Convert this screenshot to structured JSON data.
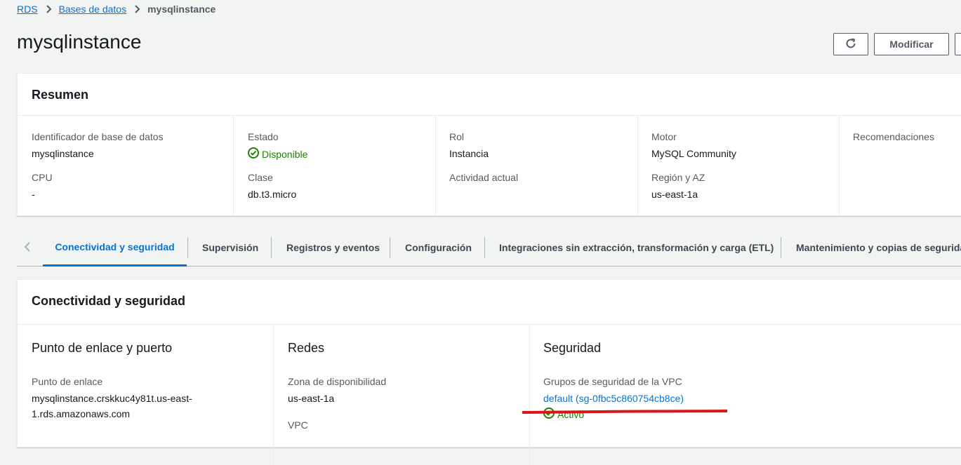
{
  "breadcrumb": {
    "items": [
      "RDS",
      "Bases de datos"
    ],
    "current": "mysqlinstance"
  },
  "header": {
    "title": "mysqlinstance",
    "modify_label": "Modificar"
  },
  "summary": {
    "title": "Resumen",
    "fields": {
      "db_id_label": "Identificador de base de datos",
      "db_id_value": "mysqlinstance",
      "cpu_label": "CPU",
      "cpu_value": "-",
      "estado_label": "Estado",
      "estado_value": "Disponible",
      "clase_label": "Clase",
      "clase_value": "db.t3.micro",
      "rol_label": "Rol",
      "rol_value": "Instancia",
      "actividad_label": "Actividad actual",
      "motor_label": "Motor",
      "motor_value": "MySQL Community",
      "region_label": "Región y AZ",
      "region_value": "us-east-1a",
      "recomendaciones_label": "Recomendaciones"
    }
  },
  "tabs": [
    "Conectividad y seguridad",
    "Supervisión",
    "Registros y eventos",
    "Configuración",
    "Integraciones sin extracción, transformación y carga (ETL)",
    "Mantenimiento y copias de seguridad"
  ],
  "connectivity": {
    "title": "Conectividad y seguridad",
    "endpoint_section": {
      "title": "Punto de enlace y puerto",
      "endpoint_label": "Punto de enlace",
      "endpoint_value_line1": "mysqlinstance.crskkuc4y81t.us-east-",
      "endpoint_value_line2": "1.rds.amazonaws.com"
    },
    "network_section": {
      "title": "Redes",
      "az_label": "Zona de disponibilidad",
      "az_value": "us-east-1a",
      "vpc_label": "VPC"
    },
    "security_section": {
      "title": "Seguridad",
      "sg_label": "Grupos de seguridad de la VPC",
      "sg_link": "default (sg-0fbc5c860754cb8ce)",
      "sg_status": "Activo"
    }
  },
  "colors": {
    "link": "#0972d3",
    "success": "#1d8102",
    "annotation": "#d91515"
  }
}
